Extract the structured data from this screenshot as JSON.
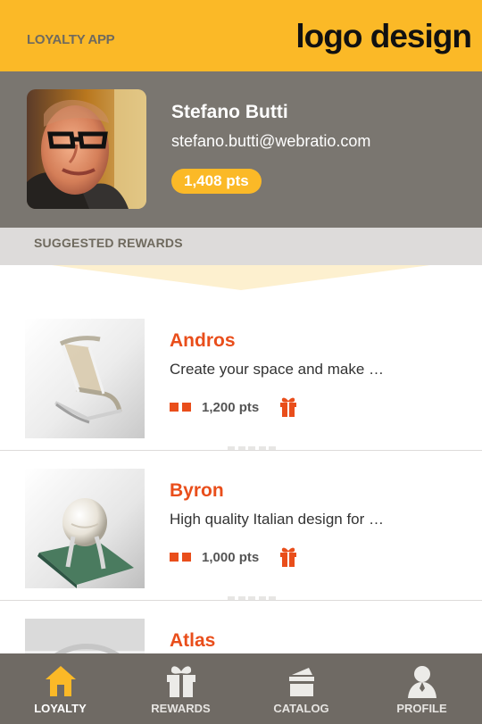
{
  "header": {
    "app_title": "LOYALTY APP",
    "logo_text": "logo design",
    "colors": {
      "accent": "#FBB927",
      "profile_background": "#7A7670",
      "section_background": "#DDDBDA",
      "reward_title": "#E94E1B",
      "nav_background": "#6F6A64"
    }
  },
  "profile": {
    "name": "Stefano Butti",
    "email": "stefano.butti@webratio.com",
    "points": "1,408 pts",
    "avatar_icon": "avatar-photo"
  },
  "suggested": {
    "title": "SUGGESTED REWARDS"
  },
  "rewards": [
    {
      "name": "Andros",
      "description": "Create your space and make …",
      "points": "1,200 pts",
      "image_icon": "chair-photo",
      "category_icon": "catalog-icon",
      "gift_icon": "gift-icon"
    },
    {
      "name": "Byron",
      "description": "High quality Italian design for …",
      "points": "1,000 pts",
      "image_icon": "ball-chair-photo",
      "category_icon": "catalog-icon",
      "gift_icon": "gift-icon"
    },
    {
      "name": "Atlas",
      "image_icon": "product-photo"
    }
  ],
  "nav": {
    "items": [
      {
        "label": "LOYALTY",
        "icon": "home-icon",
        "active": true
      },
      {
        "label": "REWARDS",
        "icon": "gift-icon",
        "active": false
      },
      {
        "label": "CATALOG",
        "icon": "catalog-icon",
        "active": false
      },
      {
        "label": "PROFILE",
        "icon": "user-icon",
        "active": false
      }
    ]
  }
}
